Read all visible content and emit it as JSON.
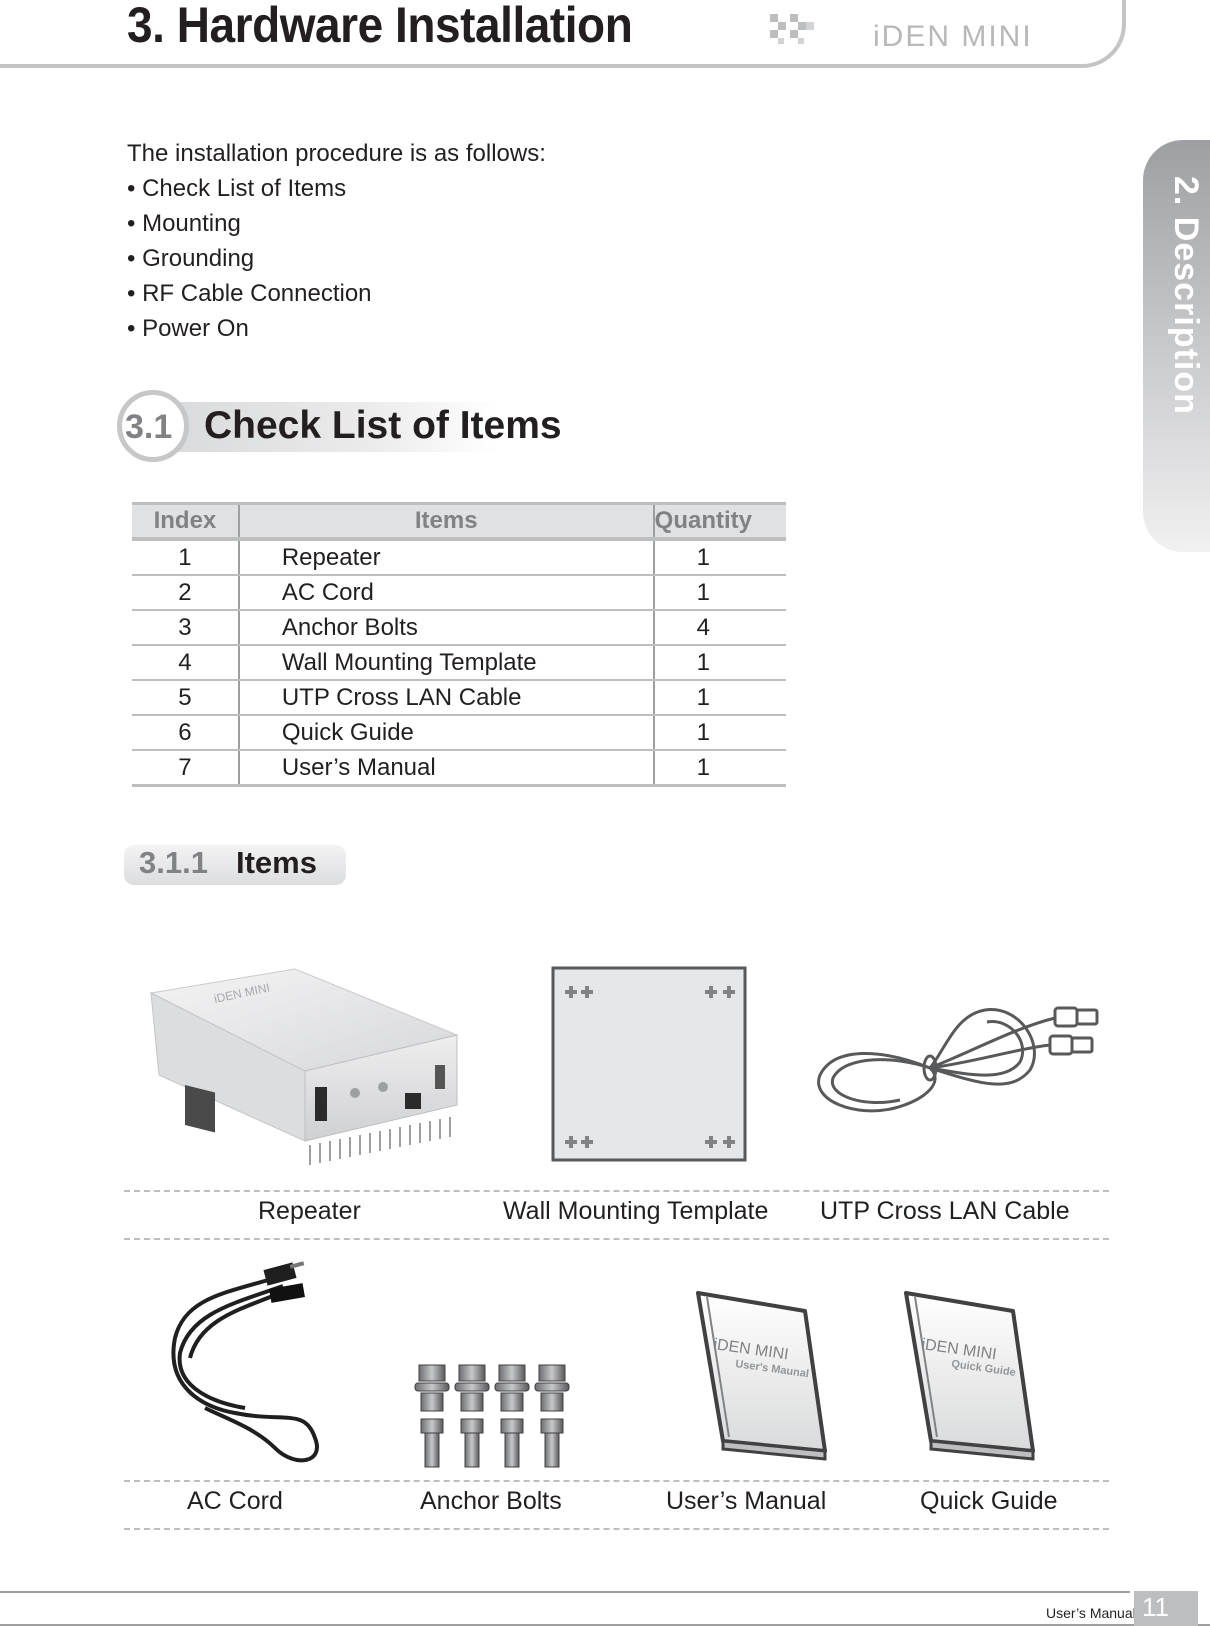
{
  "header": {
    "title": "3. Hardware Installation",
    "brand": "iDEN MINI",
    "arrows_icon": "double-chevron-right-icon"
  },
  "side_tab": {
    "label": "2. Description"
  },
  "intro": {
    "lead": "The installation procedure is as follows:",
    "steps": [
      "Check List of Items",
      "Mounting",
      "Grounding",
      "RF Cable Connection",
      "Power On"
    ]
  },
  "section": {
    "number": "3.1",
    "title": "Check List of Items"
  },
  "table": {
    "headers": [
      "Index",
      "Items",
      "Quantity"
    ],
    "rows": [
      {
        "index": "1",
        "item": "Repeater",
        "qty": "1"
      },
      {
        "index": "2",
        "item": "AC Cord",
        "qty": "1"
      },
      {
        "index": "3",
        "item": "Anchor Bolts",
        "qty": "4"
      },
      {
        "index": "4",
        "item": "Wall Mounting Template",
        "qty": "1"
      },
      {
        "index": "5",
        "item": "UTP Cross LAN Cable",
        "qty": "1"
      },
      {
        "index": "6",
        "item": "Quick Guide",
        "qty": "1"
      },
      {
        "index": "7",
        "item": "User’s Manual",
        "qty": "1"
      }
    ]
  },
  "subsection": {
    "number": "3.1.1",
    "title": "Items"
  },
  "gallery": {
    "row1": [
      "Repeater",
      "Wall Mounting Template",
      "UTP Cross LAN Cable"
    ],
    "row2": [
      "AC Cord",
      "Anchor Bolts",
      "User’s Manual",
      "Quick Guide"
    ],
    "repeater_brand": "iDEN MINI",
    "manual_cover": {
      "brand": "iDEN MINI",
      "subtitle": "User's Maunal"
    },
    "guide_cover": {
      "brand": "iDEN MINI",
      "subtitle": "Quick Guide"
    }
  },
  "footer": {
    "label": "User’s Manual",
    "page": "11"
  }
}
